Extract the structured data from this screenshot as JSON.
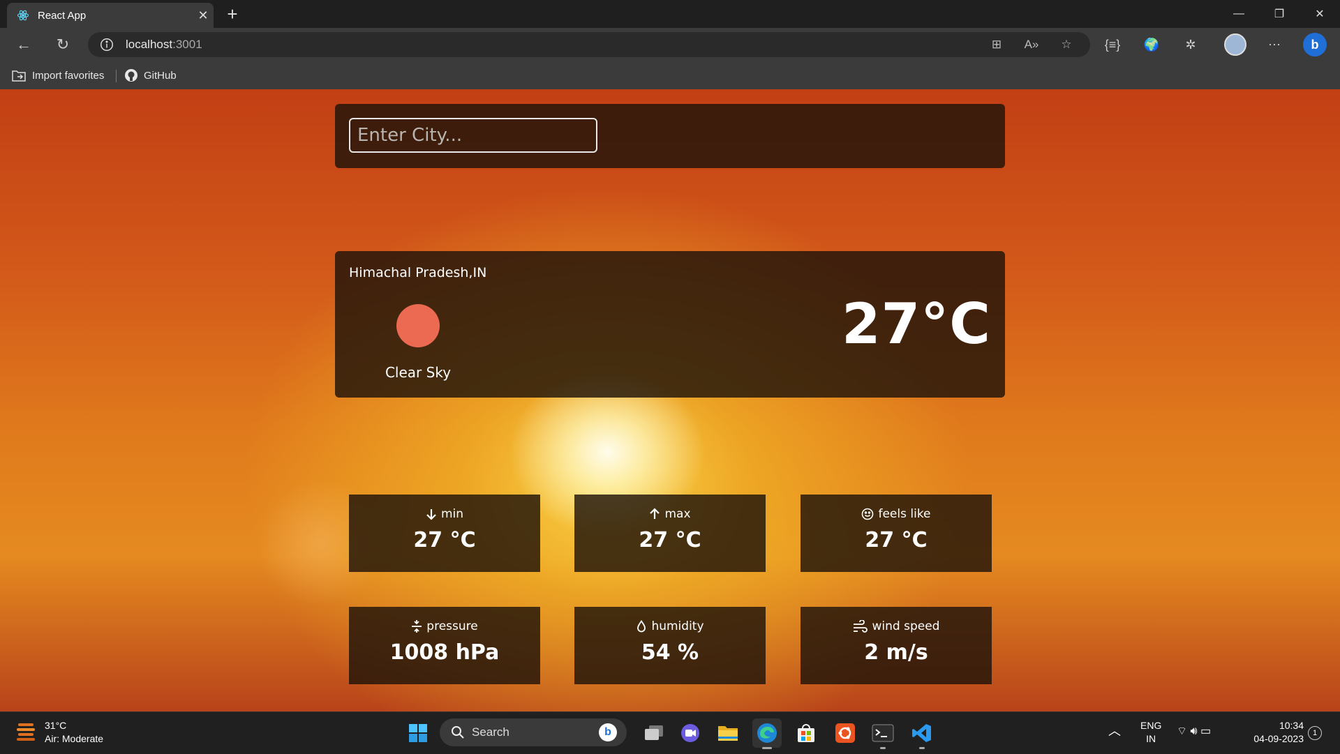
{
  "browser": {
    "tab_title": "React App",
    "url_host": "localhost",
    "url_port": ":3001",
    "favorites": [
      {
        "label": "Import favorites"
      },
      {
        "label": "GitHub"
      }
    ]
  },
  "app": {
    "search": {
      "placeholder": "Enter City..."
    },
    "location": "Himachal Pradesh,IN",
    "condition": "Clear Sky",
    "temperature": "27°C",
    "stats": [
      {
        "label": "min",
        "value": "27 °C",
        "icon": "arrow-down-icon"
      },
      {
        "label": "max",
        "value": "27 °C",
        "icon": "arrow-up-icon"
      },
      {
        "label": "feels like",
        "value": "27 °C",
        "icon": "smile-icon"
      },
      {
        "label": "pressure",
        "value": "1008 hPa",
        "icon": "compress-icon"
      },
      {
        "label": "humidity",
        "value": "54 %",
        "icon": "droplet-icon"
      },
      {
        "label": "wind speed",
        "value": "2 m/s",
        "icon": "wind-icon"
      }
    ]
  },
  "taskbar": {
    "weather_temp": "31°C",
    "weather_desc": "Air: Moderate",
    "search_label": "Search",
    "lang_top": "ENG",
    "lang_bottom": "IN",
    "time": "10:34",
    "date": "04-09-2023",
    "notification_count": "1"
  },
  "colors": {
    "sun_dot": "#ec6a52",
    "panel": "#20140a"
  }
}
